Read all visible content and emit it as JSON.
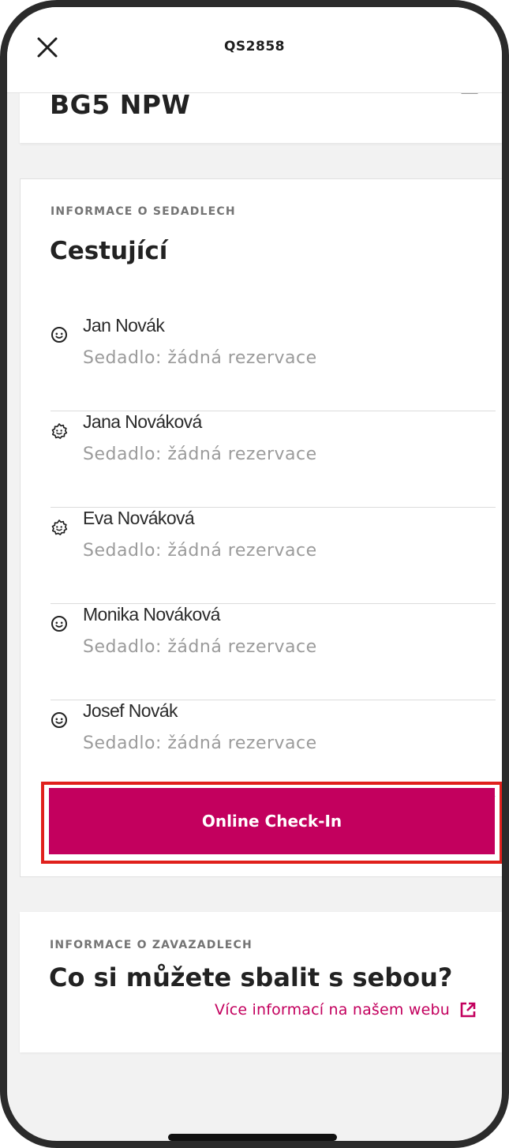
{
  "header": {
    "title": "QS2858",
    "close_icon": "close-icon"
  },
  "vehicle_card": {
    "plate": "BG5 NPW",
    "icon": "card-corner-icon"
  },
  "seat_info": {
    "eyebrow": "INFORMACE O SEDADLECH",
    "heading": "Cestující",
    "passengers": [
      {
        "name": "Jan Novák",
        "seat": "Sedadlo: žádná rezervace",
        "icon": "adult-face-icon"
      },
      {
        "name": "Jana Nováková",
        "seat": "Sedadlo: žádná rezervace",
        "icon": "child-face-icon"
      },
      {
        "name": "Eva Nováková",
        "seat": "Sedadlo: žádná rezervace",
        "icon": "child-face-icon"
      },
      {
        "name": "Monika Nováková",
        "seat": "Sedadlo: žádná rezervace",
        "icon": "adult-face-icon"
      },
      {
        "name": "Josef Novák",
        "seat": "Sedadlo: žádná rezervace",
        "icon": "adult-face-icon"
      }
    ],
    "checkin_label": "Online Check-In"
  },
  "baggage_info": {
    "eyebrow": "INFORMACE O ZAVAZADLECH",
    "heading": "Co si můžete sbalit s sebou?",
    "link_label": "Více informací na našem webu",
    "link_icon": "external-link-icon"
  },
  "colors": {
    "accent": "#c3005e",
    "highlight_outline": "#e0201c",
    "text_primary": "#222222",
    "text_muted": "#9b9b9b",
    "background": "#f2f2f2"
  }
}
